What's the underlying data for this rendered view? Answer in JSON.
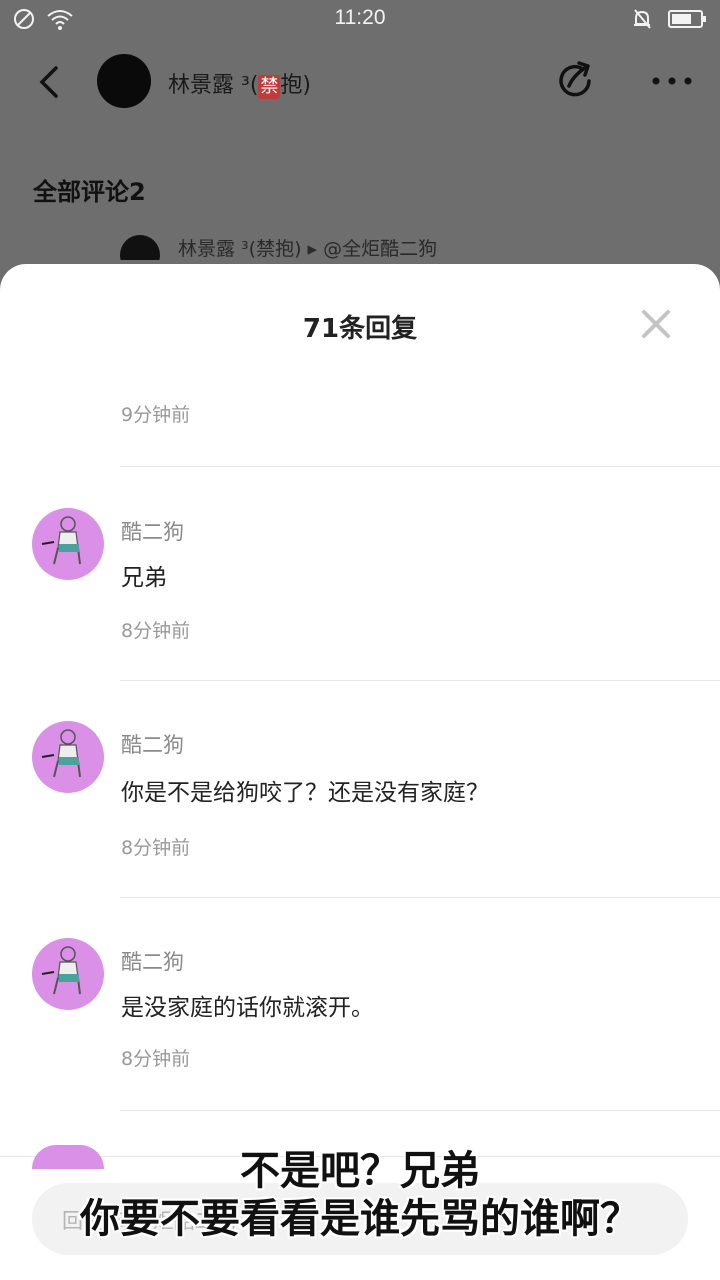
{
  "status_bar": {
    "time": "11:20"
  },
  "post": {
    "author_name": "林景露 ³(",
    "author_badge": "禁",
    "author_name_tail": "抱)",
    "section_title": "全部评论2",
    "peek_comment": "林景露 ³(禁抱) ▸ @全炬酷二狗"
  },
  "sheet": {
    "title": "71条回复",
    "first_time": "9分钟前",
    "replies": [
      {
        "name": "酷二狗",
        "content": "兄弟",
        "time": "8分钟前"
      },
      {
        "name": "酷二狗",
        "content": "你是不是给狗咬了？还是没有家庭？",
        "time": "8分钟前"
      },
      {
        "name": "酷二狗",
        "content": "是没家庭的话你就滚开。",
        "time": "8分钟前"
      }
    ],
    "input_placeholder": "回复 @全炬酷二狗"
  },
  "subtitles": {
    "line1": "不是吧？兄弟",
    "line2": "你要不要看看是谁先骂的谁啊？"
  },
  "colors": {
    "overlay": "#6e6e6e",
    "avatar_bg": "#d990e6",
    "badge": "#c23b3b"
  }
}
